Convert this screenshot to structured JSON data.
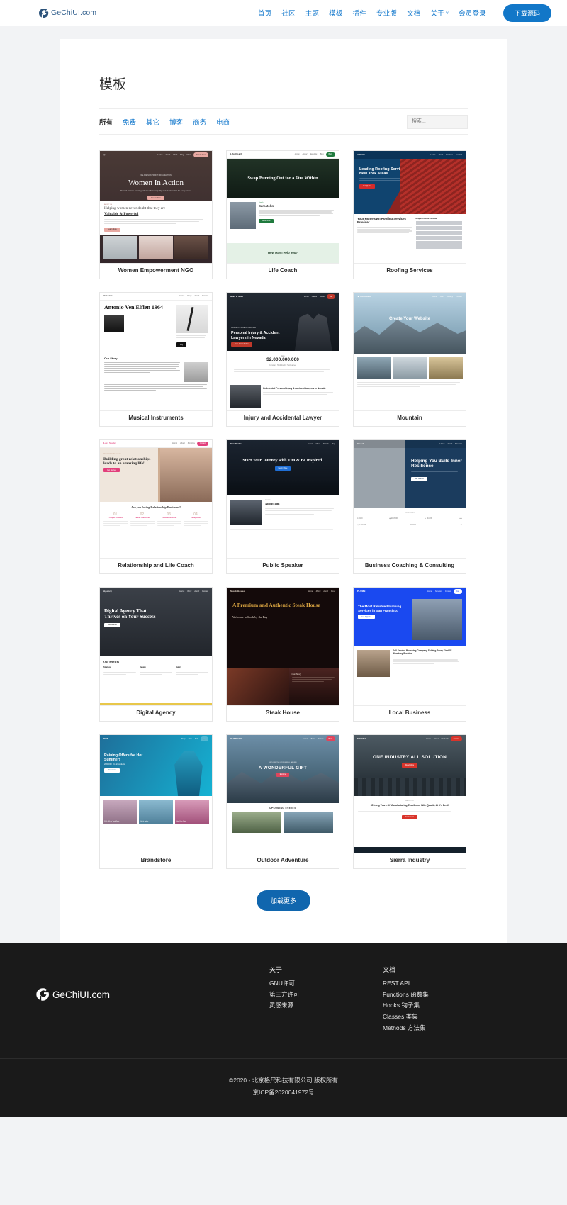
{
  "header": {
    "brand": "GeChiUI.com",
    "nav": [
      {
        "label": "首页"
      },
      {
        "label": "社区"
      },
      {
        "label": "主题"
      },
      {
        "label": "模板"
      },
      {
        "label": "插件"
      },
      {
        "label": "专业版"
      },
      {
        "label": "文档"
      },
      {
        "label": "关于",
        "caret": "˅"
      },
      {
        "label": "会员登录"
      }
    ],
    "download_button": "下载源码"
  },
  "main": {
    "page_title": "模板",
    "filters": [
      {
        "label": "所有",
        "active": true
      },
      {
        "label": "免费",
        "active": false
      },
      {
        "label": "其它",
        "active": false
      },
      {
        "label": "博客",
        "active": false
      },
      {
        "label": "商务",
        "active": false
      },
      {
        "label": "电商",
        "active": false
      }
    ],
    "search": {
      "placeholder": "搜索...",
      "value": ""
    },
    "load_more": "加载更多",
    "templates": [
      {
        "name": "Women Empowerment NGO",
        "hero_title": "Women In Action",
        "hero_sub": "We work towards ensuring a life free from inequality and discrimination for every women.",
        "hero_cta": "Donate Now",
        "section_eyebrow": "ABOUT US",
        "section_title": "Helping women never doubt that they are",
        "section_title_em": "Valuable & Powerful",
        "section_cta": "Learn More",
        "accent": "#e8a9a2"
      },
      {
        "name": "Life Coach",
        "brand": "Life Coach",
        "hero_title": "Swap Burning Out for a Fire Within",
        "person_label": "Coach",
        "person_name": "Sara John",
        "cta": "Book Now",
        "band_text": "How May I Help You?",
        "accent": "#1f7a3d"
      },
      {
        "name": "Roofing Services",
        "brand": "ATTAR",
        "hero_title": "Leading Roofing Service In New York Areas",
        "sub_title": "Your Hometown Roofing Services Provider",
        "sub_cta": "Request A Free Estimate",
        "accent": "#d32b2b"
      },
      {
        "name": "Musical Instruments",
        "brand": "Antonio",
        "hero_title": "Antonio Ven Elfien 1964",
        "section_title": "Our Story",
        "accent": "#111111"
      },
      {
        "name": "Injury and Accidental Lawyer",
        "hero_title": "Personal Injury & Accident Lawyers in Nevada",
        "cta": "Free Consultation",
        "stat_label": "Won",
        "stat_value": "$2,000,000,000",
        "stat_sub": "Constant, Hard fought, Hard earned",
        "band_text": "Undefeated Personal Injury & Accident Lawyers in Nevada",
        "accent": "#c0392b"
      },
      {
        "name": "Mountain",
        "hero_title": "Create Your Website",
        "accent": "#2bb6b0"
      },
      {
        "name": "Relationship and Life Coach",
        "brand": "Love Magic",
        "hero_title": "Building great relationships leads to an amazing life!",
        "cta": "Get Started",
        "section_title": "Are you facing Relationship Problems?",
        "steps": [
          "01.",
          "02.",
          "03.",
          "04."
        ],
        "step_labels": [
          "Couples Problems",
          "Parents Child Issues",
          "Commitment Issues",
          "Family Issues"
        ],
        "accent": "#e23f7b"
      },
      {
        "name": "Public Speaker",
        "brand": "TimWalker",
        "hero_title": "Start Your Journey with Tim & Be Inspired.",
        "cta": "Learn More",
        "section_title": "About Tim",
        "accent": "#1f6fd6"
      },
      {
        "name": "Business Coaching & Consulting",
        "hero_title": "Helping You Build Inner Resilience.",
        "cta": "Get Started",
        "accent": "#1b3c5e"
      },
      {
        "name": "Digital Agency",
        "hero_title": "Digital Agency That Thrives on Your Success",
        "cta": "Get Started",
        "section_title": "Our Services",
        "service_cols": [
          "Strategy",
          "Design",
          "Build"
        ],
        "accent": "#e8c74a"
      },
      {
        "name": "Steak House",
        "brand": "Steak House",
        "hero_title": "A Premium and Authentic Steak House",
        "section_title": "Welcome to Steak by the Bay",
        "story_title": "Our Story",
        "accent": "#a0221f"
      },
      {
        "name": "Local Business",
        "hero_title": "The Most Reliable Plumbing Services in San Francisco",
        "cta": "Get A Quote",
        "section_title": "Full-Service Plumbing Company Solving Every Kind Of Plumbing Problem",
        "accent": "#1a49f0"
      },
      {
        "name": "Brandstore",
        "brand": "BNK",
        "hero_title": "Raining Offers for Hot Summer!",
        "hero_sub": "20% OFF On all products",
        "cta": "Shop Now",
        "tiles": [
          "20% Off on Tank Tops",
          "Get it today",
          "Get Your Pair"
        ],
        "accent": "#15b2d3"
      },
      {
        "name": "Outdoor Adventure",
        "hero_title": "A WONDERFUL GIFT",
        "cta": "Explore",
        "section_title": "UPCOMING EVENTS",
        "accent": "#e0455c"
      },
      {
        "name": "Sierra Industry",
        "brand": "SIERRA",
        "hero_title": "ONE INDUSTRY ALL SOLUTION",
        "cta": "Read More",
        "section_title": "35 Long Years Of Manufacturing Excellence With Quality At It's Best!",
        "section_cta": "Contact Us",
        "accent": "#d9342b"
      }
    ]
  },
  "footer": {
    "brand": "GeChiUI.com",
    "columns": [
      {
        "title": "关于",
        "links": [
          "GNU许可",
          "第三方许可",
          "灵感来源"
        ]
      },
      {
        "title": "文档",
        "links": [
          "REST API",
          "Functions 函数集",
          "Hooks 钩子集",
          "Classes 类集",
          "Methods 方法集"
        ]
      }
    ],
    "copyright": "©2020 - 北京格尺科技有限公司 版权所有",
    "icp": "京ICP备2020041972号"
  },
  "colors": {
    "primary": "#1277c8",
    "link": "#1177cc",
    "footer_bg": "#1a1a1a",
    "page_bg": "#f2f3f5"
  }
}
